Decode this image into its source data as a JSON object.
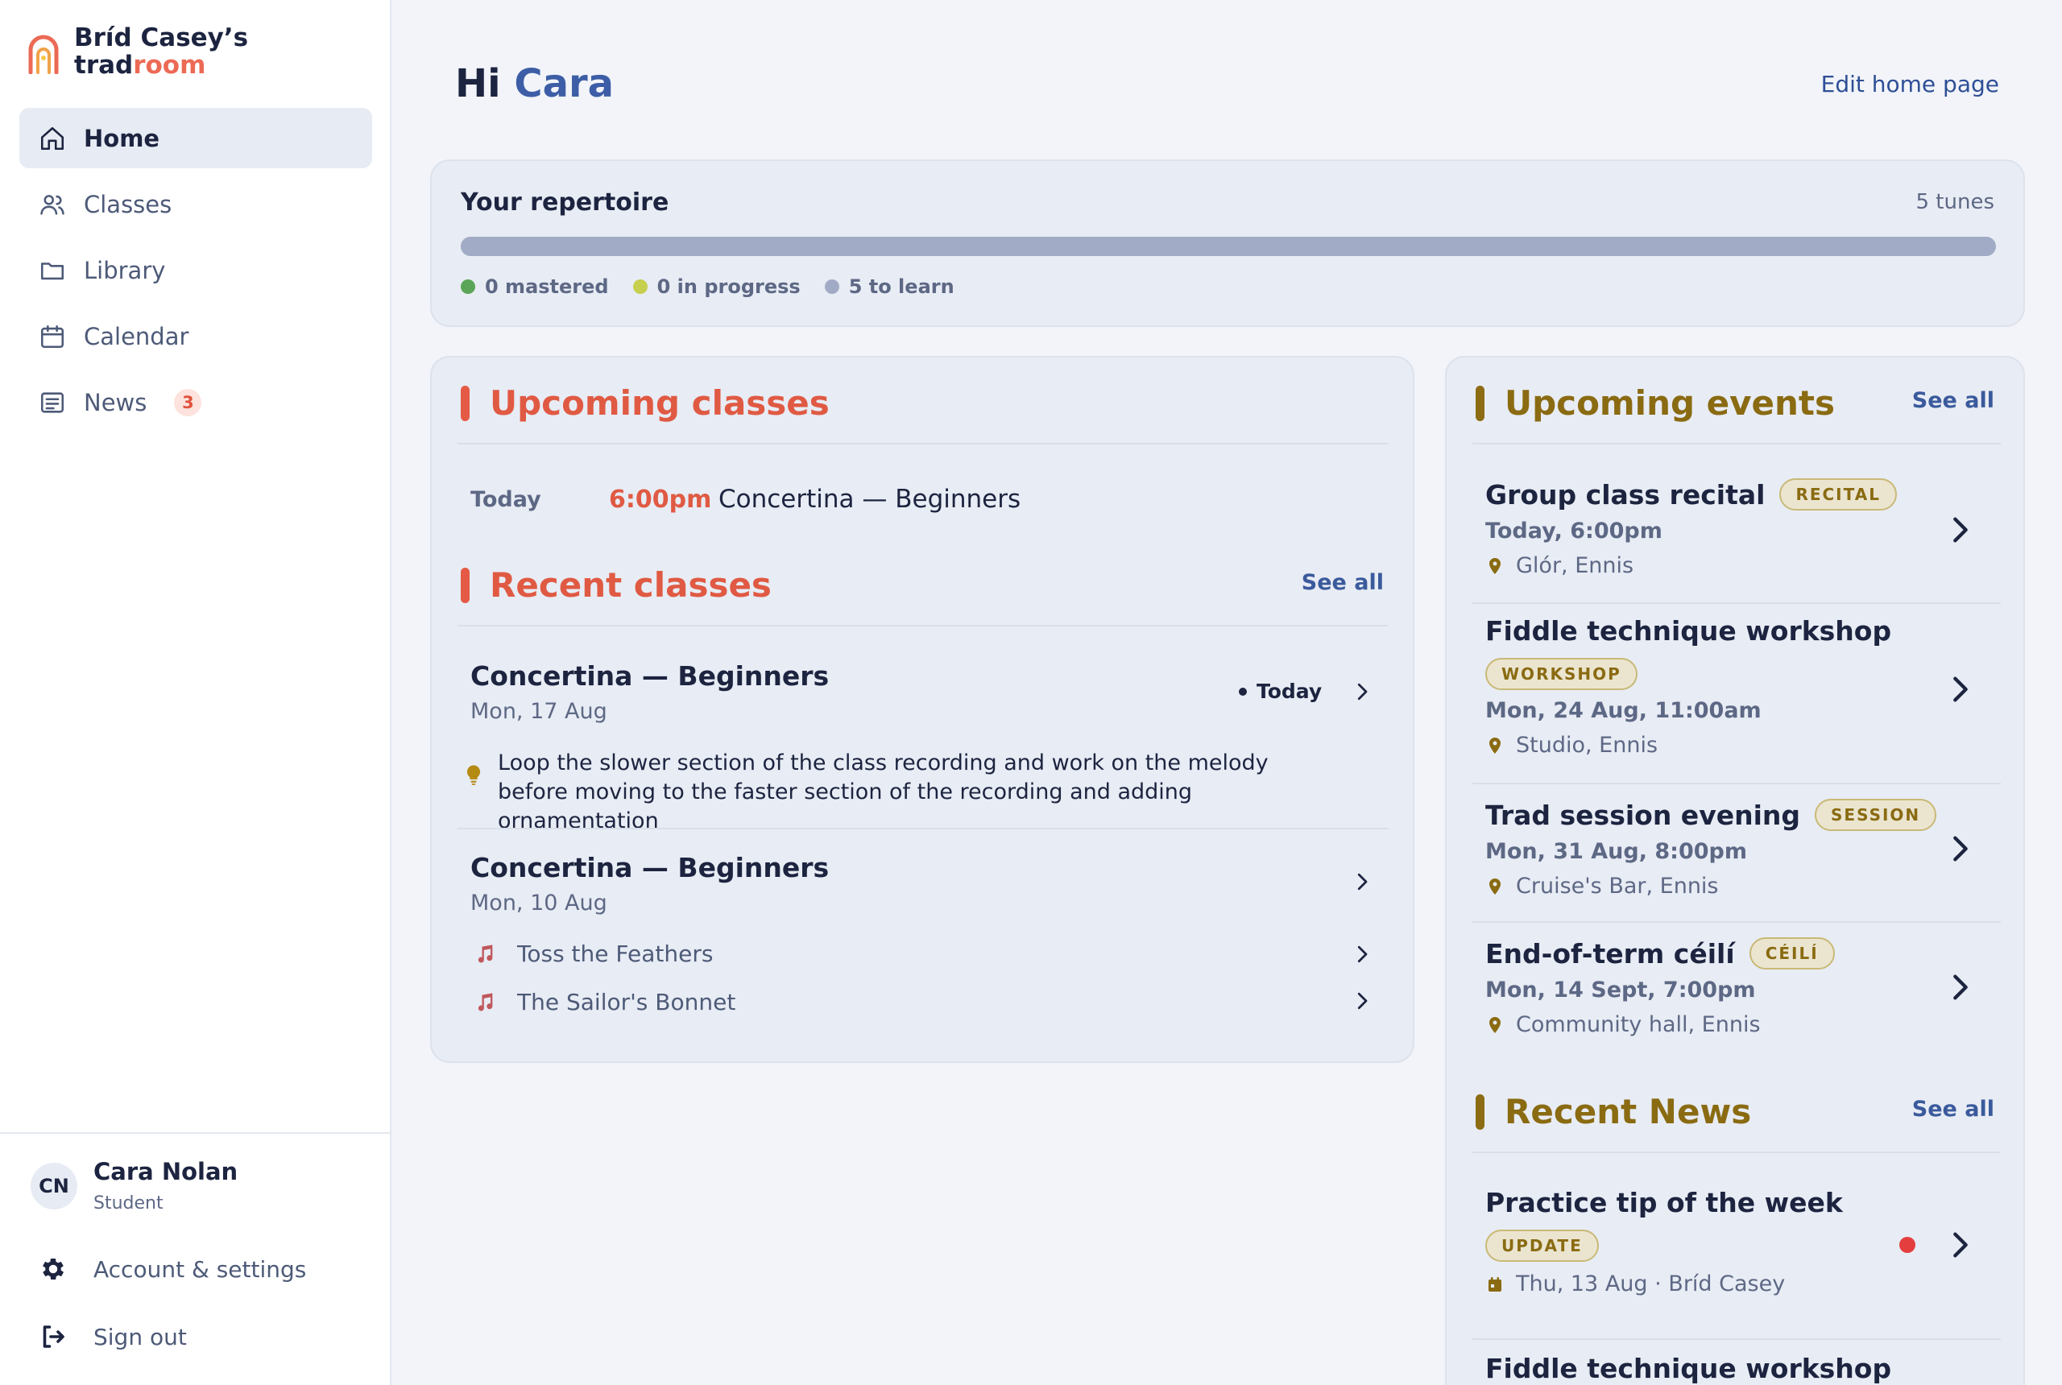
{
  "brand": {
    "line1": "Bríd Casey’s",
    "line2a": "trad",
    "line2b": "room"
  },
  "nav": [
    {
      "label": "Home",
      "icon": "home-icon",
      "active": true
    },
    {
      "label": "Classes",
      "icon": "users-icon"
    },
    {
      "label": "Library",
      "icon": "folder-icon"
    },
    {
      "label": "Calendar",
      "icon": "calendar-icon"
    },
    {
      "label": "News",
      "icon": "newspaper-icon",
      "badge": "3"
    }
  ],
  "user": {
    "initials": "CN",
    "name": "Cara Nolan",
    "role": "Student"
  },
  "footer": {
    "account": "Account & settings",
    "signout": "Sign out"
  },
  "header": {
    "greeting": "Hi",
    "name": "Cara",
    "edit": "Edit home page"
  },
  "repertoire": {
    "title": "Your repertoire",
    "count": "5 tunes",
    "mastered_fraction": 0,
    "legend": [
      {
        "label": "0 mastered",
        "color": "#5aa558"
      },
      {
        "label": "0 in progress",
        "color": "#c6cf4e"
      },
      {
        "label": "5 to learn",
        "color": "#a2abc6"
      }
    ]
  },
  "upcoming_classes": {
    "title": "Upcoming classes",
    "items": [
      {
        "day": "Today",
        "time": "6:00pm",
        "name": "Concertina — Beginners"
      }
    ]
  },
  "recent_classes": {
    "title": "Recent classes",
    "see_all": "See all",
    "items": [
      {
        "title": "Concertina — Beginners",
        "date": "Mon, 17 Aug",
        "pill": "Today",
        "tip": "Loop the slower section of the class recording and work on the melody before moving to the faster section of the recording and adding ornamentation"
      },
      {
        "title": "Concertina — Beginners",
        "date": "Mon, 10 Aug",
        "tunes": [
          "Toss the Feathers",
          "The Sailor's Bonnet"
        ]
      }
    ]
  },
  "upcoming_events": {
    "title": "Upcoming events",
    "see_all": "See all",
    "items": [
      {
        "title": "Group class recital",
        "tag": "RECITAL",
        "when": "Today, 6:00pm",
        "where": "Glór, Ennis"
      },
      {
        "title": "Fiddle technique workshop",
        "tag": "WORKSHOP",
        "when": "Mon, 24 Aug, 11:00am",
        "where": "Studio, Ennis"
      },
      {
        "title": "Trad session evening",
        "tag": "SESSION",
        "when": "Mon, 31 Aug, 8:00pm",
        "where": "Cruise's Bar, Ennis"
      },
      {
        "title": "End-of-term céilí",
        "tag": "CÉILÍ",
        "when": "Mon, 14 Sept, 7:00pm",
        "where": "Community hall, Ennis"
      }
    ]
  },
  "recent_news": {
    "title": "Recent News",
    "see_all": "See all",
    "items": [
      {
        "title": "Practice tip of the week",
        "tag": "UPDATE",
        "meta": "Thu, 13 Aug · Bríd Casey"
      },
      {
        "title": "Fiddle technique workshop"
      }
    ]
  },
  "colors": {
    "accent_red": "#e05a43",
    "accent_gold": "#8a6b12",
    "link_blue": "#3a5a9c",
    "unread": "#e53e3e"
  }
}
